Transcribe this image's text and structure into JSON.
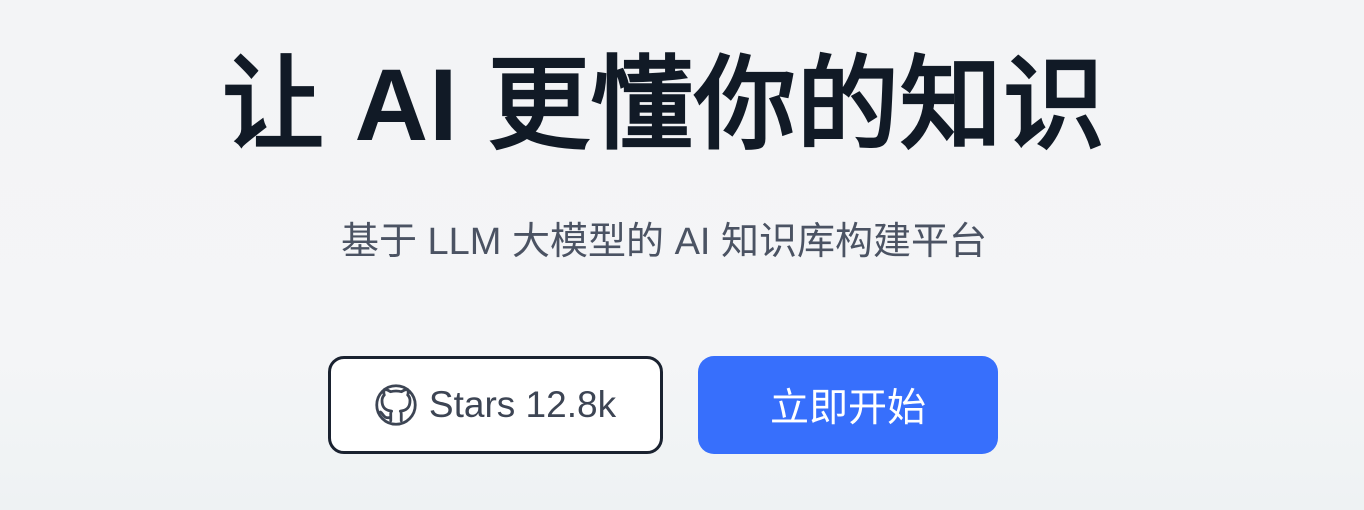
{
  "hero": {
    "title": "让 AI 更懂你的知识",
    "subtitle": "基于 LLM 大模型的 AI 知识库构建平台"
  },
  "buttons": {
    "github": {
      "icon": "github-icon",
      "label": "Stars 12.8k"
    },
    "start": {
      "label": "立即开始"
    }
  },
  "colors": {
    "background": "#f3f4f6",
    "title": "#111a26",
    "subtitle": "#4b5363",
    "primary": "#376ffc",
    "github_border": "#1a2230"
  }
}
